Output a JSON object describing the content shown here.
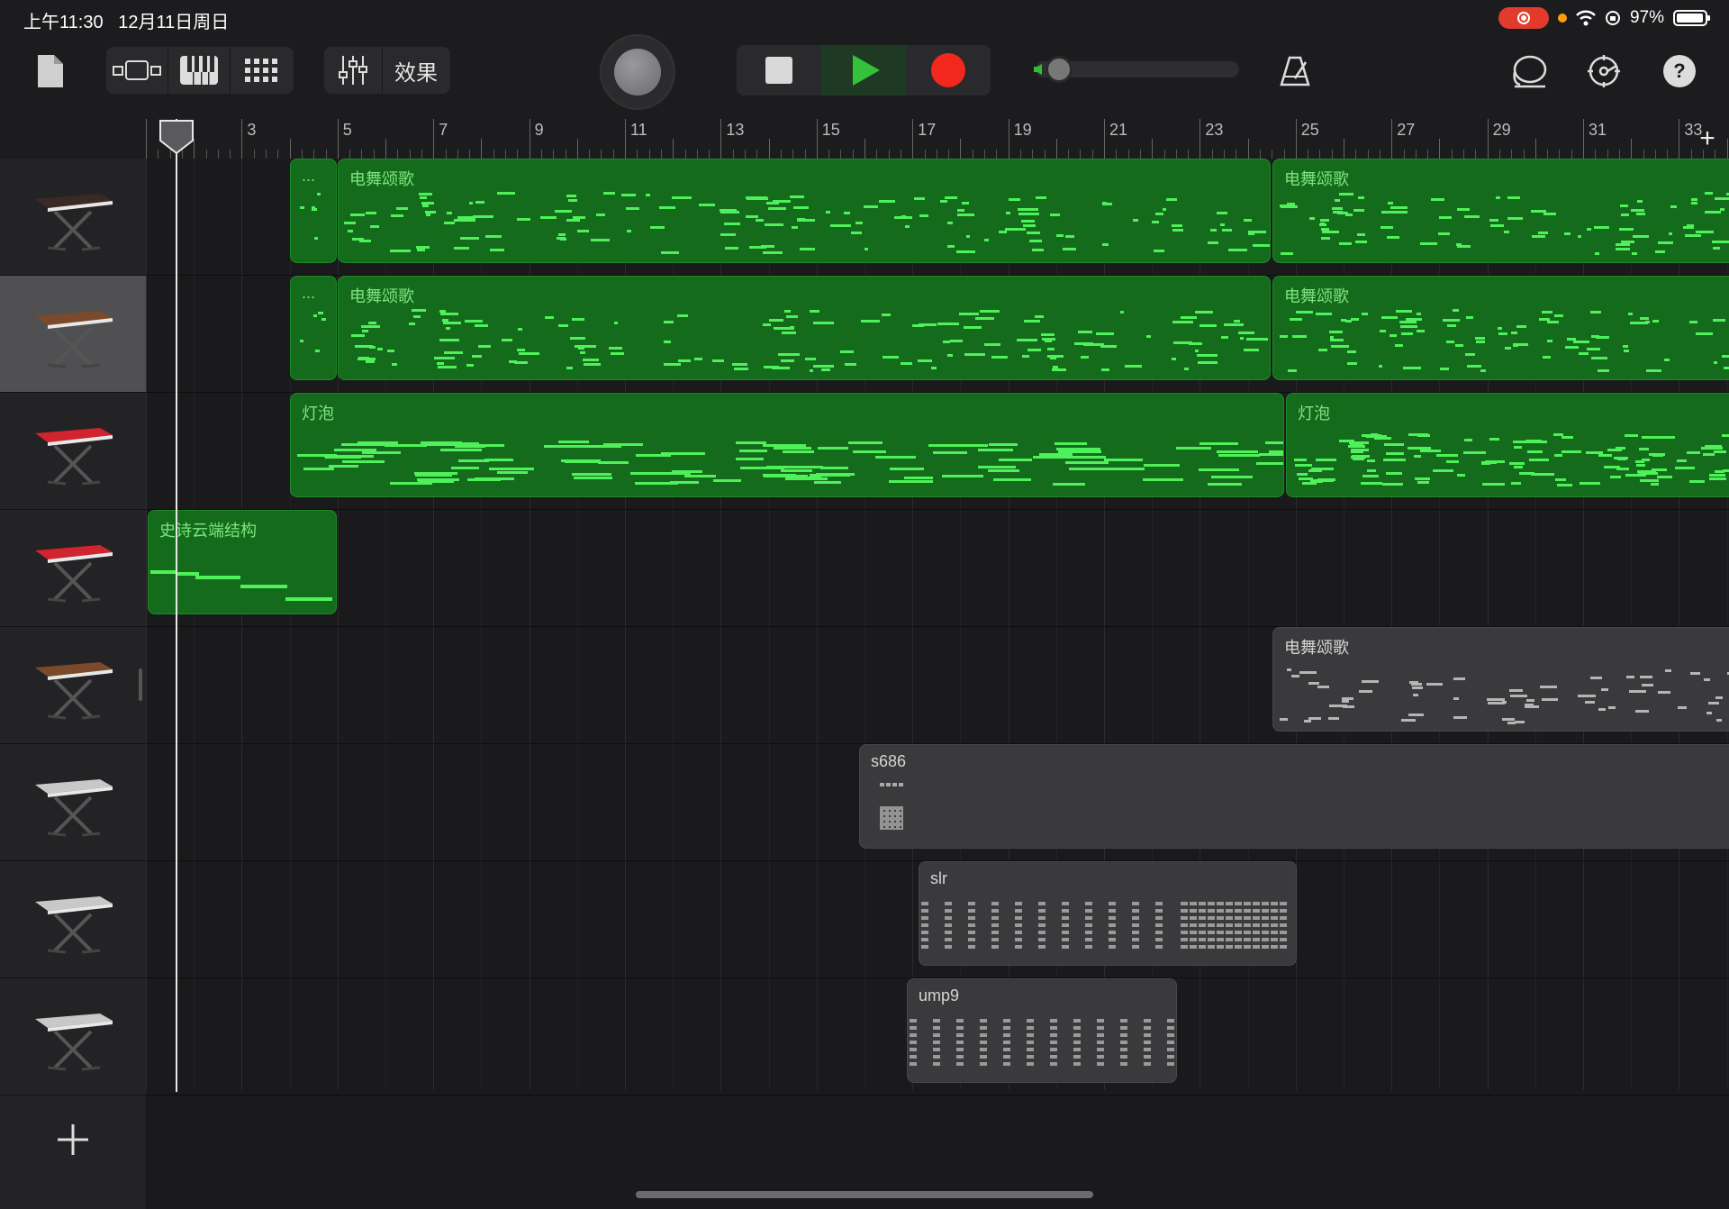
{
  "status_bar": {
    "time": "上午11:30",
    "date": "12月11日周日",
    "battery": "97%",
    "battery_level": 0.97
  },
  "toolbar": {
    "effects_label": "效果",
    "icons": [
      "document-icon",
      "track-view-icon",
      "keyboard-icon",
      "grid-icon",
      "mixer-icon",
      "record-knob",
      "stop-icon",
      "play-icon",
      "record-icon",
      "volume-slider",
      "metronome-icon",
      "loop-icon",
      "settings-icon",
      "help-icon"
    ],
    "volume_level": 0.05,
    "accent_play": "#33c23a",
    "accent_record": "#f2281e"
  },
  "ruler": {
    "bars": [
      "3",
      "5",
      "7",
      "9",
      "11",
      "13",
      "15",
      "17",
      "19",
      "21",
      "23",
      "25",
      "27",
      "29",
      "31",
      "33"
    ],
    "add_symbol": "+"
  },
  "tracks": [
    {
      "instrument": "keyboard-dark",
      "selected": false
    },
    {
      "instrument": "keyboard-synth",
      "selected": true
    },
    {
      "instrument": "keyboard-red",
      "selected": false
    },
    {
      "instrument": "keyboard-red",
      "selected": false
    },
    {
      "instrument": "keyboard-synth",
      "selected": false
    },
    {
      "instrument": "keyboard-silver",
      "selected": false
    },
    {
      "instrument": "keyboard-silver",
      "selected": false
    },
    {
      "instrument": "keyboard-silver",
      "selected": false
    }
  ],
  "regions": {
    "t1a": {
      "label": "..."
    },
    "t1b": {
      "label": "电舞颂歌"
    },
    "t1c": {
      "label": "电舞颂歌"
    },
    "t2a": {
      "label": "..."
    },
    "t2b": {
      "label": "电舞颂歌"
    },
    "t2c": {
      "label": "电舞颂歌"
    },
    "t3a": {
      "label": "灯泡"
    },
    "t3b": {
      "label": "灯泡"
    },
    "t4a": {
      "label": "史诗云端结构"
    },
    "t5a": {
      "label": "电舞颂歌"
    },
    "t6a": {
      "label": "s686"
    },
    "t7a": {
      "label": "slr"
    },
    "t8a": {
      "label": "ump9"
    }
  },
  "colors": {
    "region_green": "#156b1c",
    "note_green": "#4ff15a",
    "region_gray": "#3a3a3c"
  }
}
